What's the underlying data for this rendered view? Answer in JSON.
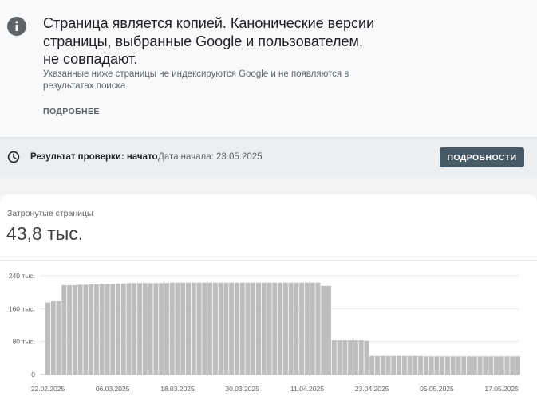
{
  "issue": {
    "icon": "info-icon",
    "title": "Страница является копией. Канонические версии страницы, выбранные Google и пользователем, не совпадают.",
    "description": "Указанные ниже страницы не индексируются Google и не появляются в результатах поиска.",
    "learn_more": "ПОДРОБНЕЕ"
  },
  "validation": {
    "icon": "clock-icon",
    "label": "Результат проверки: начато",
    "start_date": "Дата начала: 23.05.2025",
    "button": "ПОДРОБНОСТИ",
    "button_color": "#455a64"
  },
  "metric": {
    "label": "Затронутые страницы",
    "value": "43,8 тыс."
  },
  "chart_data": {
    "type": "bar",
    "color": "#bdbdbd",
    "ylim": [
      0,
      240000
    ],
    "yticks": [
      {
        "value": 0,
        "label": "0"
      },
      {
        "value": 80000,
        "label": "80 тыс."
      },
      {
        "value": 160000,
        "label": "160 тыс."
      },
      {
        "value": 240000,
        "label": "240 тыс."
      }
    ],
    "xtick_labels": [
      "22.02.2025",
      "06.03.2025",
      "18.03.2025",
      "30.03.2025",
      "11.04.2025",
      "23.04.2025",
      "05.05.2025",
      "17.05.2025"
    ],
    "xtick_indices": [
      0,
      12,
      24,
      36,
      48,
      60,
      72,
      84
    ],
    "grid": true,
    "values": [
      175000,
      178000,
      178000,
      217000,
      217000,
      217000,
      218000,
      218000,
      219000,
      219000,
      220000,
      220000,
      220000,
      221000,
      221000,
      222000,
      222000,
      222000,
      222000,
      222000,
      222000,
      222000,
      222000,
      223000,
      223000,
      223000,
      223000,
      223000,
      223000,
      223000,
      223000,
      223000,
      223000,
      223000,
      223000,
      223000,
      223000,
      223000,
      223000,
      223000,
      223000,
      223000,
      223000,
      223000,
      223000,
      223000,
      223000,
      223000,
      223000,
      223000,
      223000,
      215000,
      215000,
      83000,
      83000,
      83000,
      83000,
      83000,
      83000,
      82000,
      45000,
      45000,
      45000,
      45000,
      45000,
      45000,
      45000,
      45000,
      45000,
      45000,
      44000,
      44000,
      44000,
      44000,
      44000,
      44000,
      44000,
      44000,
      44000,
      44000,
      44000,
      44000,
      44000,
      44000,
      44000,
      44000,
      44000,
      44000
    ]
  }
}
